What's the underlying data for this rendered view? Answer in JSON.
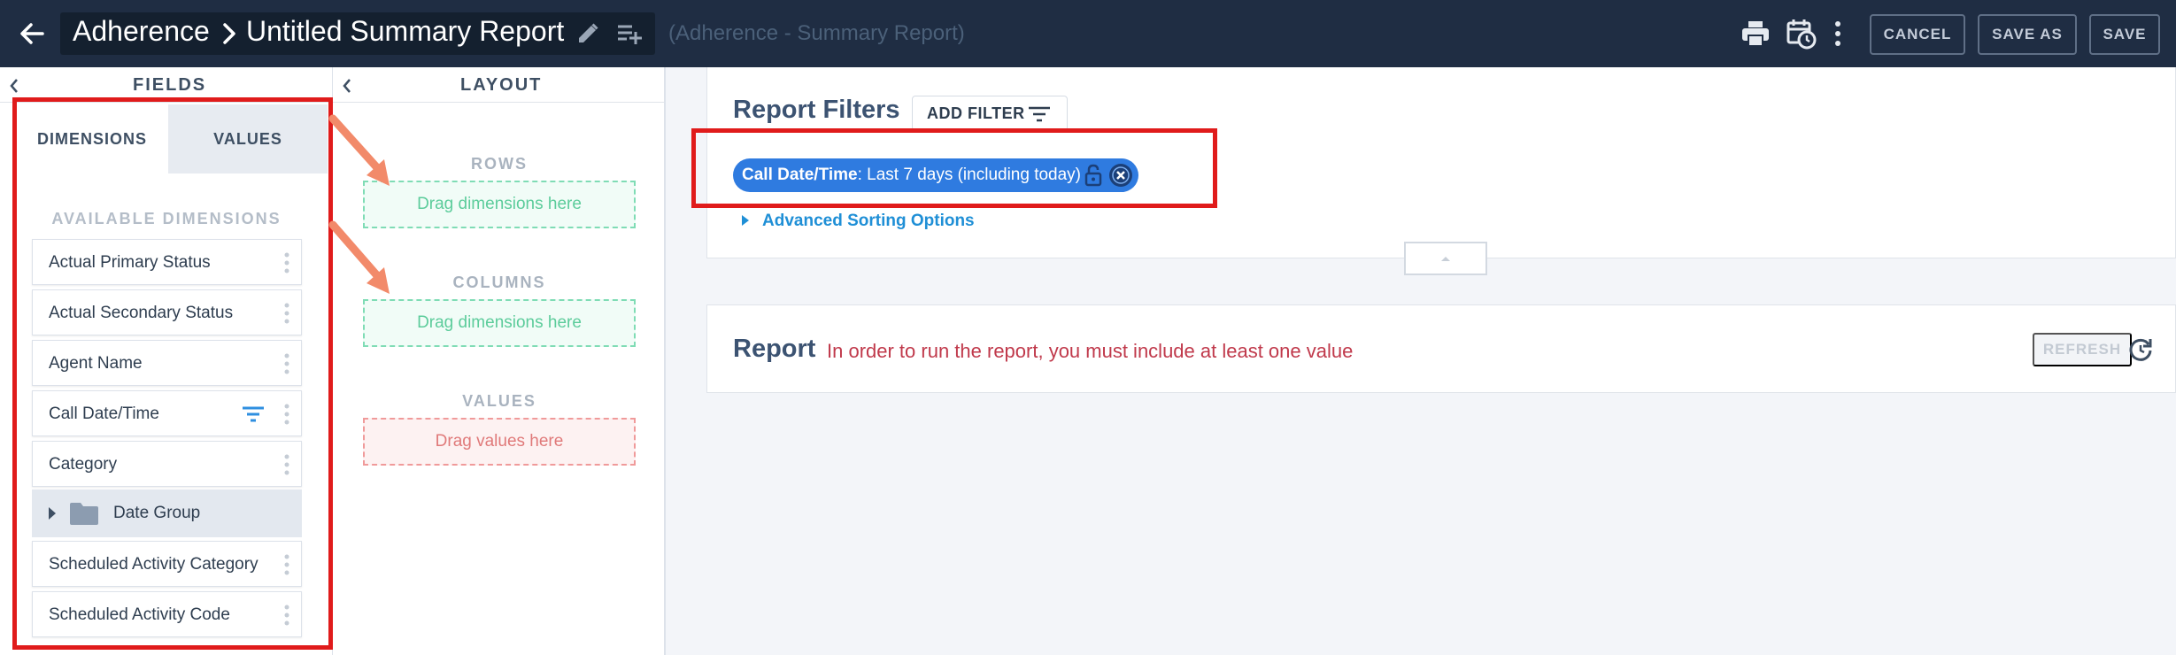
{
  "header": {
    "breadcrumb_root": "Adherence",
    "report_name": "Untitled Summary Report",
    "subtitle": "(Adherence - Summary Report)",
    "buttons": {
      "cancel": "CANCEL",
      "save_as": "SAVE AS",
      "save": "SAVE"
    },
    "icons": [
      "back-arrow-icon",
      "chevron-right-icon",
      "pencil-icon",
      "playlist-add-icon",
      "print-icon",
      "schedule-icon",
      "kebab-menu-icon"
    ]
  },
  "fields_panel": {
    "title": "FIELDS",
    "tabs": {
      "dimensions": "DIMENSIONS",
      "values": "VALUES"
    },
    "active_tab": "dimensions",
    "available_label": "AVAILABLE DIMENSIONS",
    "items": [
      {
        "label": "Actual Primary Status"
      },
      {
        "label": "Actual Secondary Status"
      },
      {
        "label": "Agent Name"
      },
      {
        "label": "Call Date/Time",
        "filtered": true
      },
      {
        "label": "Category"
      },
      {
        "label": "Date Group",
        "group": true
      },
      {
        "label": "Scheduled Activity Category"
      },
      {
        "label": "Scheduled Activity Code"
      }
    ]
  },
  "layout_panel": {
    "title": "LAYOUT",
    "rows": {
      "title": "ROWS",
      "placeholder": "Drag dimensions here"
    },
    "columns": {
      "title": "COLUMNS",
      "placeholder": "Drag dimensions here"
    },
    "values": {
      "title": "VALUES",
      "placeholder": "Drag values here"
    }
  },
  "report_filters": {
    "title": "Report Filters",
    "add_filter_label": "ADD FILTER",
    "chip": {
      "field": "Call Date/Time",
      "value": ": Last 7 days (including today)"
    },
    "advanced_sorting": "Advanced Sorting Options"
  },
  "report": {
    "title": "Report",
    "message": "In order to run the report, you must include at least one value",
    "refresh_label": "REFRESH"
  },
  "colors": {
    "header_bg": "#1f2d43",
    "accent_blue": "#2f7be0",
    "error_red": "#c0394b",
    "annotation_red": "#e01b1b",
    "annotation_arrow": "#f28a6a"
  }
}
